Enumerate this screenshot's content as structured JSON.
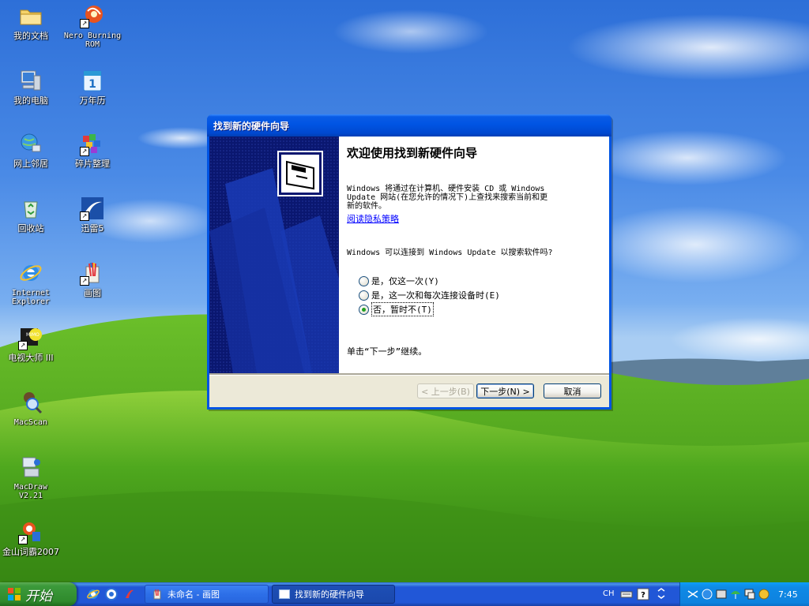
{
  "desktop": {
    "icons": [
      {
        "label": "我的文档",
        "icon": "folder-icon"
      },
      {
        "label": "Nero Burning ROM",
        "icon": "nero-icon"
      },
      {
        "label": "我的电脑",
        "icon": "computer-icon"
      },
      {
        "label": "万年历",
        "icon": "calendar-icon"
      },
      {
        "label": "网上邻居",
        "icon": "network-icon"
      },
      {
        "label": "碎片整理",
        "icon": "defrag-icon"
      },
      {
        "label": "回收站",
        "icon": "recycle-bin-icon"
      },
      {
        "label": "迅雷5",
        "icon": "thunder-icon"
      },
      {
        "label": "Internet Explorer",
        "icon": "ie-icon"
      },
      {
        "label": "画图",
        "icon": "paint-icon"
      },
      {
        "label": "电视大师 III",
        "icon": "tv-master-icon"
      },
      {
        "label": "MacScan",
        "icon": "macscan-icon"
      },
      {
        "label": "MacDraw V2.21",
        "icon": "macdraw-icon"
      },
      {
        "label": "金山词霸2007",
        "icon": "kingsoft-icon"
      }
    ]
  },
  "dialog": {
    "title": "找到新的硬件向导",
    "heading": "欢迎使用找到新硬件向导",
    "intro_line1": "Windows 将通过在计算机、硬件安装 CD 或 Windows",
    "intro_line2": "Update 网站(在您允许的情况下)上查找来搜索当前和更",
    "intro_line3": "新的软件。",
    "privacy_link": "阅读隐私策略",
    "question": "Windows 可以连接到 Windows Update 以搜索软件吗?",
    "options": [
      {
        "label": "是，仅这一次(Y)",
        "selected": false
      },
      {
        "label": "是，这一次和每次连接设备时(E)",
        "selected": false
      },
      {
        "label": "否，暂时不(T)",
        "selected": true
      }
    ],
    "continue_text": "单击“下一步”继续。",
    "buttons": {
      "back": "< 上一步(B)",
      "next": "下一步(N) >",
      "cancel": "取消"
    }
  },
  "taskbar": {
    "start_label": "开始",
    "tasks": [
      {
        "label": "未命名 - 画图",
        "icon": "paint-icon"
      },
      {
        "label": "找到新的硬件向导",
        "icon": "window-icon"
      }
    ],
    "lang": "CH",
    "clock": "7:45"
  },
  "colors": {
    "titlebar": "#0054e3",
    "dialog_face": "#ece9d8",
    "wizard_sidebar": "#0a1770",
    "link": "#0000ff",
    "taskbar": "#2157d7",
    "start_button": "#2f8a2c",
    "tray": "#0d82df"
  }
}
